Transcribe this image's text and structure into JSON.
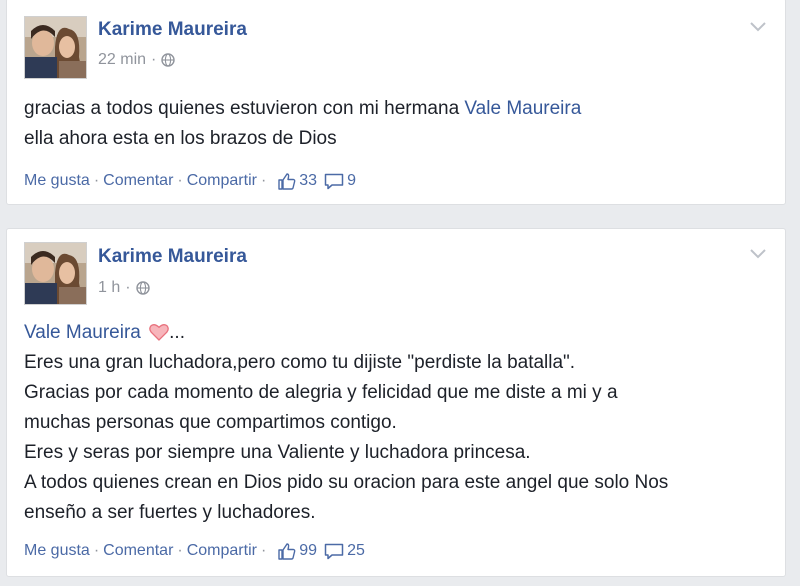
{
  "posts": [
    {
      "author": "Karime Maureira",
      "time": "22 min",
      "privacy_icon": "globe-icon",
      "lines": [
        {
          "text": "gracias a todos quienes estuvieron con mi hermana ",
          "link": "Vale Maureira"
        },
        {
          "text": "ella ahora esta en los brazos de Dios"
        }
      ],
      "actions": {
        "like": "Me gusta",
        "comment": "Comentar",
        "share": "Compartir"
      },
      "likes": "33",
      "comments": "9"
    },
    {
      "author": "Karime Maureira",
      "time": "1 h",
      "privacy_icon": "globe-icon",
      "mention": "Vale Maureira",
      "mention_suffix": "...",
      "lines": [
        "Eres una gran luchadora,pero como tu dijiste \"perdiste la batalla\".",
        "Gracias por cada momento de alegria y felicidad que me diste a mi y a",
        "muchas personas que compartimos contigo.",
        "Eres y seras por siempre una Valiente y luchadora princesa.",
        "A todos quienes crean en Dios pido su oracion para este angel que solo Nos",
        "enseño a ser fuertes y luchadores."
      ],
      "actions": {
        "like": "Me gusta",
        "comment": "Comentar",
        "share": "Compartir"
      },
      "likes": "99",
      "comments": "25"
    }
  ],
  "separator": "·",
  "colors": {
    "link": "#365899",
    "text": "#1d2129",
    "meta": "#90949c",
    "background": "#e9ebee",
    "heart": "#e8727e"
  }
}
